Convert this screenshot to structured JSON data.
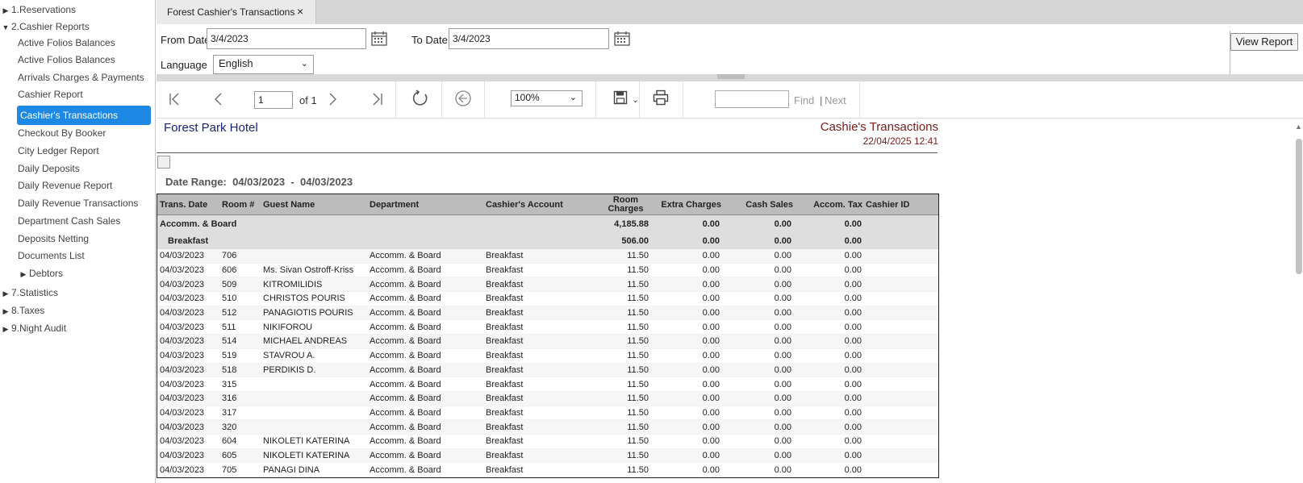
{
  "sidebar": {
    "top_items": [
      {
        "label": "1.Reservations",
        "expanded": false
      },
      {
        "label": "2.Cashier Reports",
        "expanded": true
      }
    ],
    "cashier_items": [
      "Active Folios Balances",
      "Active Folios Balances",
      "Arrivals Charges & Payments",
      "Cashier Report",
      "Cashier's Transactions",
      "Checkout By Booker",
      "City Ledger Report",
      "Daily Deposits",
      "Daily Revenue Report",
      "Daily Revenue Transactions",
      "Department Cash Sales",
      "Deposits Netting",
      "Documents List"
    ],
    "active_item": "Cashier's Transactions",
    "debtors_label": "Debtors",
    "bottom_items": [
      {
        "label": "7.Statistics"
      },
      {
        "label": "8.Taxes"
      },
      {
        "label": "9.Night Audit"
      }
    ]
  },
  "tab": {
    "label": "Forest Cashier's Transactions",
    "close": "×"
  },
  "params": {
    "from_label": "From Date",
    "from_value": "3/4/2023",
    "to_label": "To Date",
    "to_value": "3/4/2023",
    "language_label": "Language",
    "language_value": "English",
    "view_report_label": "View Report"
  },
  "toolbar": {
    "page_value": "1",
    "page_of": "of 1",
    "zoom_value": "100%",
    "find_placeholder": "",
    "find_label": "Find",
    "find_separator": "|",
    "next_label": "Next"
  },
  "report": {
    "hotel_name": "Forest Park Hotel",
    "title": "Cashie's Transactions",
    "datetime": "22/04/2025 12:41",
    "date_range_label": "Date Range:",
    "date_range_from": "04/03/2023",
    "date_range_sep": "-",
    "date_range_to": "04/03/2023",
    "columns": [
      "Trans. Date",
      "Room #",
      "Guest Name",
      "Department",
      "Cashier's Account",
      "Room Charges",
      "Extra Charges",
      "Cash Sales",
      "Accom. Tax",
      "Cashier ID"
    ],
    "group": {
      "name": "Accomm.  & Board",
      "room": "4,185.88",
      "extra": "0.00",
      "cash": "0.00",
      "tax": "0.00"
    },
    "subgroup": {
      "name": "Breakfast",
      "room": "506.00",
      "extra": "0.00",
      "cash": "0.00",
      "tax": "0.00"
    },
    "rows": [
      {
        "date": "04/03/2023",
        "room": "706",
        "guest": "",
        "dept": "Accomm.  & Board",
        "account": "Breakfast",
        "rc": "11.50",
        "ec": "0.00",
        "cs": "0.00",
        "tax": "0.00"
      },
      {
        "date": "04/03/2023",
        "room": "606",
        "guest": "Ms. Sivan Ostroff-Kriss",
        "dept": "Accomm.  & Board",
        "account": "Breakfast",
        "rc": "11.50",
        "ec": "0.00",
        "cs": "0.00",
        "tax": "0.00"
      },
      {
        "date": "04/03/2023",
        "room": "509",
        "guest": " KITROMILIDIS",
        "dept": "Accomm.  & Board",
        "account": "Breakfast",
        "rc": "11.50",
        "ec": "0.00",
        "cs": "0.00",
        "tax": "0.00"
      },
      {
        "date": "04/03/2023",
        "room": "510",
        "guest": " CHRISTOS POURIS",
        "dept": "Accomm.  & Board",
        "account": "Breakfast",
        "rc": "11.50",
        "ec": "0.00",
        "cs": "0.00",
        "tax": "0.00"
      },
      {
        "date": "04/03/2023",
        "room": "512",
        "guest": " PANAGIOTIS POURIS",
        "dept": "Accomm.  & Board",
        "account": "Breakfast",
        "rc": "11.50",
        "ec": "0.00",
        "cs": "0.00",
        "tax": "0.00"
      },
      {
        "date": "04/03/2023",
        "room": "511",
        "guest": " NIKIFOROU",
        "dept": "Accomm.  & Board",
        "account": "Breakfast",
        "rc": "11.50",
        "ec": "0.00",
        "cs": "0.00",
        "tax": "0.00"
      },
      {
        "date": "04/03/2023",
        "room": "514",
        "guest": " MICHAEL ANDREAS",
        "dept": "Accomm.  & Board",
        "account": "Breakfast",
        "rc": "11.50",
        "ec": "0.00",
        "cs": "0.00",
        "tax": "0.00"
      },
      {
        "date": "04/03/2023",
        "room": "519",
        "guest": "STAVROU A.",
        "dept": "Accomm.  & Board",
        "account": "Breakfast",
        "rc": "11.50",
        "ec": "0.00",
        "cs": "0.00",
        "tax": "0.00"
      },
      {
        "date": "04/03/2023",
        "room": "518",
        "guest": "PERDIKIS D.",
        "dept": "Accomm.  & Board",
        "account": "Breakfast",
        "rc": "11.50",
        "ec": "0.00",
        "cs": "0.00",
        "tax": "0.00"
      },
      {
        "date": "04/03/2023",
        "room": "315",
        "guest": "",
        "dept": "Accomm.  & Board",
        "account": "Breakfast",
        "rc": "11.50",
        "ec": "0.00",
        "cs": "0.00",
        "tax": "0.00"
      },
      {
        "date": "04/03/2023",
        "room": "316",
        "guest": "",
        "dept": "Accomm.  & Board",
        "account": "Breakfast",
        "rc": "11.50",
        "ec": "0.00",
        "cs": "0.00",
        "tax": "0.00"
      },
      {
        "date": "04/03/2023",
        "room": "317",
        "guest": "",
        "dept": "Accomm.  & Board",
        "account": "Breakfast",
        "rc": "11.50",
        "ec": "0.00",
        "cs": "0.00",
        "tax": "0.00"
      },
      {
        "date": "04/03/2023",
        "room": "320",
        "guest": "",
        "dept": "Accomm.  & Board",
        "account": "Breakfast",
        "rc": "11.50",
        "ec": "0.00",
        "cs": "0.00",
        "tax": "0.00"
      },
      {
        "date": "04/03/2023",
        "room": "604",
        "guest": "NIKOLETI KATERINA",
        "dept": "Accomm.  & Board",
        "account": "Breakfast",
        "rc": "11.50",
        "ec": "0.00",
        "cs": "0.00",
        "tax": "0.00"
      },
      {
        "date": "04/03/2023",
        "room": "605",
        "guest": "NIKOLETI KATERINA",
        "dept": "Accomm.  & Board",
        "account": "Breakfast",
        "rc": "11.50",
        "ec": "0.00",
        "cs": "0.00",
        "tax": "0.00"
      },
      {
        "date": "04/03/2023",
        "room": "705",
        "guest": "PANAGI DINA",
        "dept": "Accomm.  & Board",
        "account": "Breakfast",
        "rc": "11.50",
        "ec": "0.00",
        "cs": "0.00",
        "tax": "0.00"
      }
    ]
  },
  "colors": {
    "accent": "#1e88e5",
    "hotel": "#1a237e",
    "title": "#7b1b1b",
    "header_bg": "#bcbcbc"
  }
}
